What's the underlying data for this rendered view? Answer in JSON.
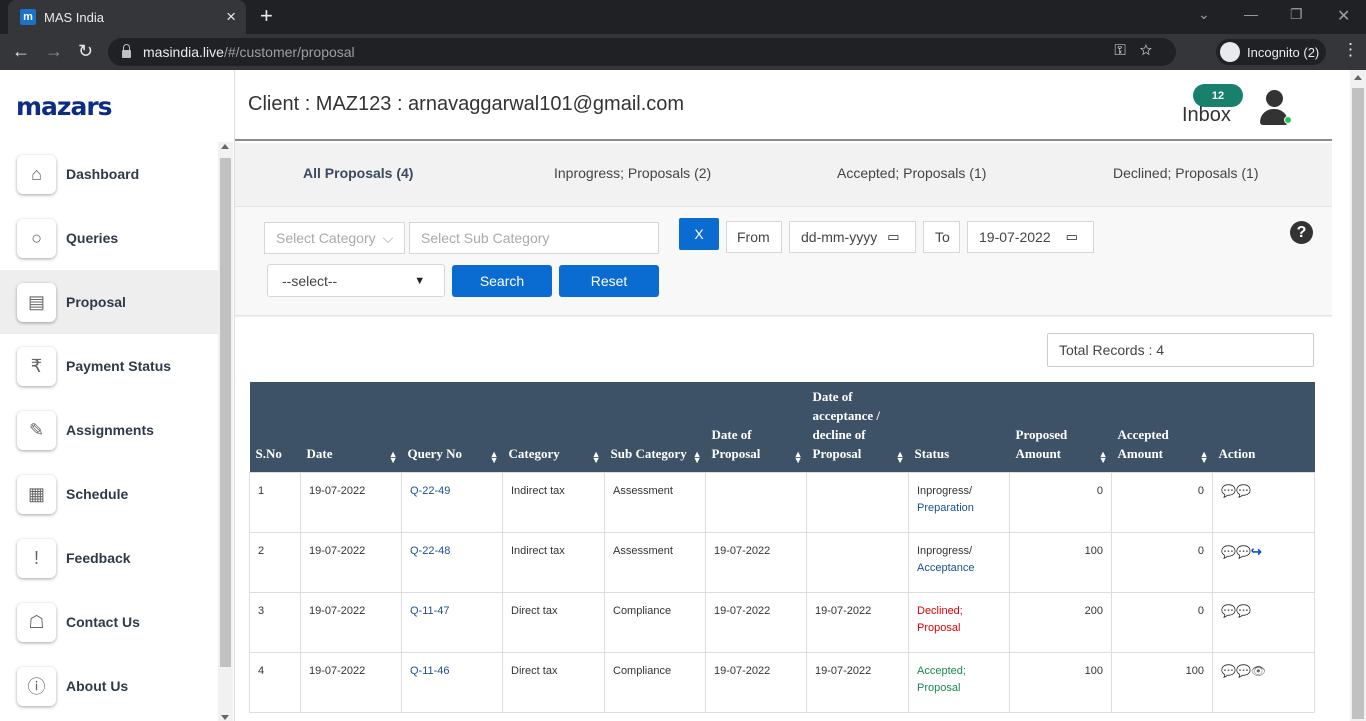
{
  "browser": {
    "tab_title": "MAS India",
    "favicon_letter": "m",
    "url_host": "masindia.live",
    "url_path": "/#/customer/proposal",
    "incognito_label": "Incognito (2)"
  },
  "sidebar": {
    "logo": "mazars",
    "items": [
      {
        "label": "Dashboard",
        "icon": "home-icon"
      },
      {
        "label": "Queries",
        "icon": "search-icon"
      },
      {
        "label": "Proposal",
        "icon": "proposal-icon",
        "active": true
      },
      {
        "label": "Payment Status",
        "icon": "rupee-cycle-icon"
      },
      {
        "label": "Assignments",
        "icon": "assignment-icon"
      },
      {
        "label": "Schedule",
        "icon": "calendar-icon"
      },
      {
        "label": "Feedback",
        "icon": "feedback-icon"
      },
      {
        "label": "Contact Us",
        "icon": "contact-book-icon"
      },
      {
        "label": "About Us",
        "icon": "info-icon"
      }
    ]
  },
  "header": {
    "client": "Client : MAZ123 : arnavaggarwal101@gmail.com",
    "inbox_count": "12",
    "inbox_label": "Inbox"
  },
  "tabs": [
    "All Proposals (4)",
    "Inprogress; Proposals (2)",
    "Accepted; Proposals (1)",
    "Declined; Proposals (1)"
  ],
  "filters": {
    "category_placeholder": "Select Category",
    "subcategory_placeholder": "Select Sub Category",
    "clear_label": "X",
    "from_label": "From",
    "from_value": "dd-mm-yyyy",
    "to_label": "To",
    "to_value": "19-07-2022",
    "select_value": "--select--",
    "search_label": "Search",
    "reset_label": "Reset",
    "help": "?"
  },
  "total_records": "Total Records : 4",
  "table": {
    "columns": [
      "S.No",
      "Date",
      "Query No",
      "Category",
      "Sub Category",
      "Date of Proposal",
      "Date of acceptance / decline of Proposal",
      "Status",
      "Proposed Amount",
      "Accepted Amount",
      "Action"
    ],
    "rows": [
      {
        "sno": "1",
        "date": "19-07-2022",
        "query": "Q-22-49",
        "category": "Indirect tax",
        "sub": "Assessment",
        "dop": "",
        "doa": "",
        "status1": "Inprogress/",
        "status2": "Preparation",
        "status_color": "inprogress",
        "proposed": "0",
        "accepted": "0",
        "actions": [
          "chat-icon",
          "chat-icon"
        ]
      },
      {
        "sno": "2",
        "date": "19-07-2022",
        "query": "Q-22-48",
        "category": "Indirect tax",
        "sub": "Assessment",
        "dop": "19-07-2022",
        "doa": "",
        "status1": "Inprogress/",
        "status2": "Acceptance",
        "status_color": "inprogress",
        "proposed": "100",
        "accepted": "0",
        "actions": [
          "chat-icon",
          "chat-icon",
          "share-icon"
        ]
      },
      {
        "sno": "3",
        "date": "19-07-2022",
        "query": "Q-11-47",
        "category": "Direct tax",
        "sub": "Compliance",
        "dop": "19-07-2022",
        "doa": "19-07-2022",
        "status1": "Declined;",
        "status2": "Proposal",
        "status_color": "declined",
        "proposed": "200",
        "accepted": "0",
        "actions": [
          "chat-icon",
          "chat-icon"
        ]
      },
      {
        "sno": "4",
        "date": "19-07-2022",
        "query": "Q-11-46",
        "category": "Direct tax",
        "sub": "Compliance",
        "dop": "19-07-2022",
        "doa": "19-07-2022",
        "status1": "Accepted;",
        "status2": "Proposal",
        "status_color": "accepted",
        "proposed": "100",
        "accepted": "100",
        "actions": [
          "chat-icon",
          "chat-icon",
          "eye-icon"
        ]
      }
    ]
  }
}
